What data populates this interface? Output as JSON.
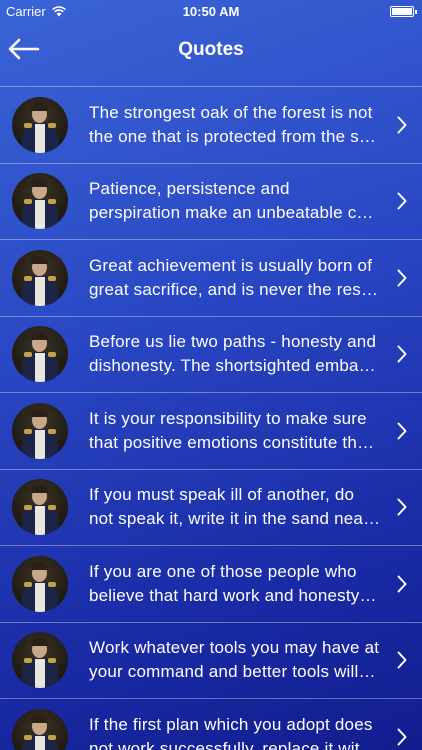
{
  "status": {
    "carrier": "Carrier",
    "time": "10:50 AM"
  },
  "nav": {
    "title": "Quotes"
  },
  "quotes": [
    [
      "The strongest oak of the forest is not",
      "the one that is protected from the s…"
    ],
    [
      "Patience, persistence and",
      "perspiration make an unbeatable c…"
    ],
    [
      "Great achievement is usually born of",
      "great sacrifice, and is never the res…"
    ],
    [
      "Before us lie two paths - honesty and",
      "dishonesty. The shortsighted emba…"
    ],
    [
      "It is your responsibility to make sure",
      "that positive emotions constitute th…"
    ],
    [
      "If you must speak ill of another, do",
      "not speak it, write it in the sand nea…"
    ],
    [
      "If you are one of those people who",
      "believe that hard work and honesty…"
    ],
    [
      "Work whatever tools you may have at",
      "your command and better tools will…"
    ],
    [
      "If the first plan which you adopt does",
      "not work successfully, replace it wit…"
    ]
  ]
}
